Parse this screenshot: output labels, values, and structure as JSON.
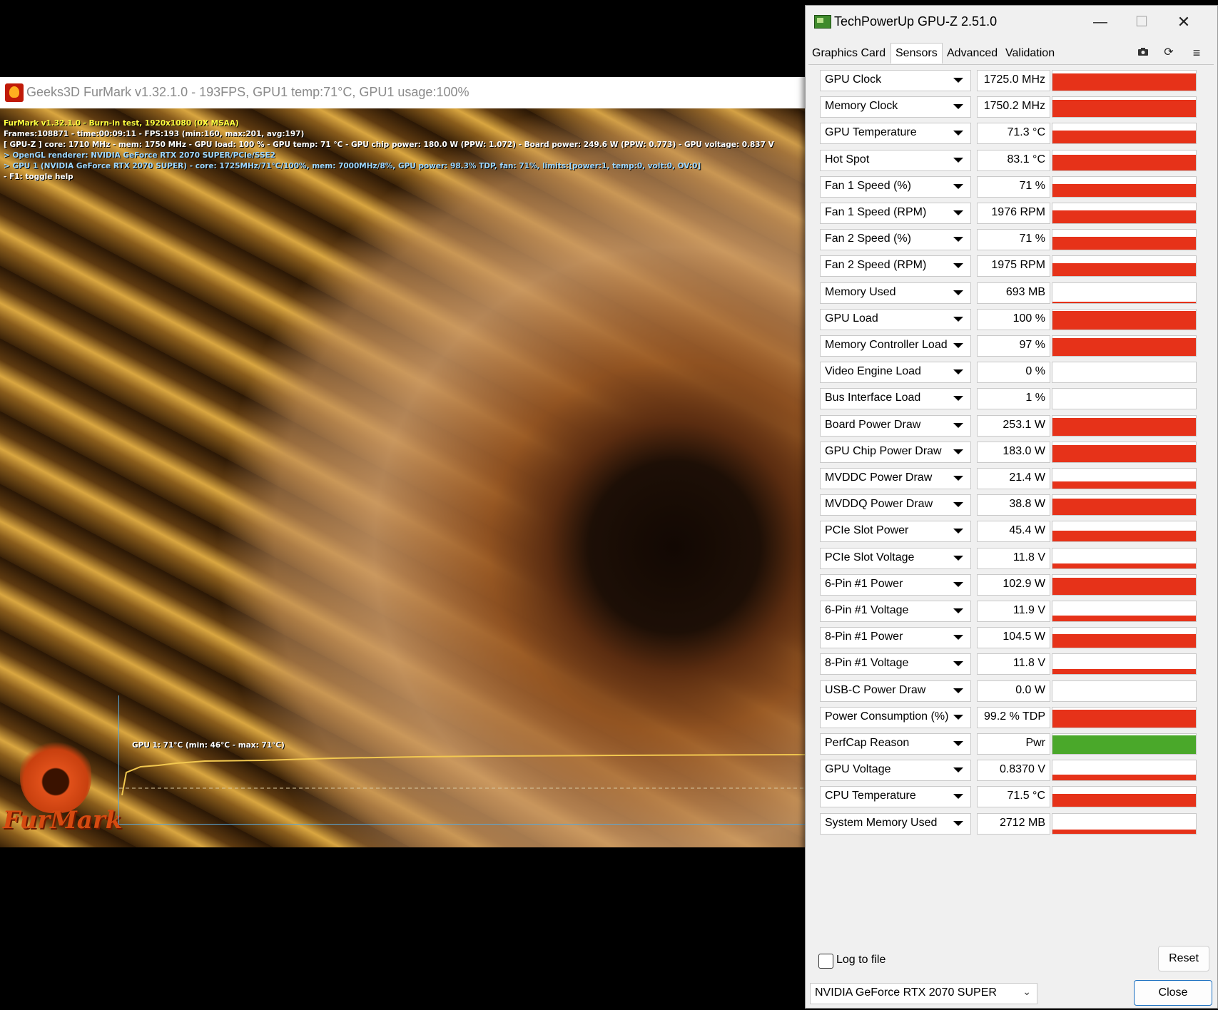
{
  "furmark": {
    "title": "Geeks3D FurMark v1.32.1.0 - 193FPS, GPU1 temp:71°C, GPU1 usage:100%",
    "hud": [
      {
        "text": "FurMark v1.32.1.0 - Burn-in test, 1920x1080 (0X MSAA)",
        "color": "yellow"
      },
      {
        "text": "Frames:108871 - time:00:09:11 - FPS:193 (min:160, max:201, avg:197)",
        "color": "white"
      },
      {
        "text": "[ GPU-Z ] core: 1710 MHz - mem: 1750 MHz - GPU load: 100 % - GPU temp: 71 °C - GPU chip power: 180.0 W (PPW: 1.072) - Board power: 249.6 W (PPW: 0.773) - GPU voltage: 0.837 V",
        "color": "white"
      },
      {
        "text": "> OpenGL renderer: NVIDIA GeForce RTX 2070 SUPER/PCIe/SSE2",
        "color": "cyan"
      },
      {
        "text": "> GPU 1 (NVIDIA GeForce RTX 2070 SUPER) - core: 1725MHz/71°C/100%, mem: 7000MHz/8%, GPU power: 98.3% TDP, fan: 71%, limits:[power:1, temp:0, volt:0, OV:0]",
        "color": "cyan"
      },
      {
        "text": "- F1: toggle help",
        "color": "white"
      }
    ],
    "graph_label": "GPU 1: 71°C (min: 46°C - max: 71°C)",
    "logo_text": "FurMark"
  },
  "gpuz": {
    "title": "TechPowerUp GPU-Z 2.51.0",
    "window_buttons": {
      "minimize": "—",
      "maximize": "☐",
      "close": "✕"
    },
    "tabs": [
      "Graphics Card",
      "Sensors",
      "Advanced",
      "Validation"
    ],
    "active_tab": "Sensors",
    "toolbar_icons": [
      "camera-icon",
      "refresh-icon",
      "menu-icon"
    ],
    "sensors": [
      {
        "name": "GPU Clock",
        "value": "1725.0 MHz",
        "level": 0.92
      },
      {
        "name": "Memory Clock",
        "value": "1750.2 MHz",
        "level": 0.92
      },
      {
        "name": "GPU Temperature",
        "value": "71.3 °C",
        "level": 0.7
      },
      {
        "name": "Hot Spot",
        "value": "83.1 °C",
        "level": 0.85
      },
      {
        "name": "Fan 1 Speed (%)",
        "value": "71 %",
        "level": 0.7
      },
      {
        "name": "Fan 1 Speed (RPM)",
        "value": "1976 RPM",
        "level": 0.7
      },
      {
        "name": "Fan 2 Speed (%)",
        "value": "71 %",
        "level": 0.7
      },
      {
        "name": "Fan 2 Speed (RPM)",
        "value": "1975 RPM",
        "level": 0.7
      },
      {
        "name": "Memory Used",
        "value": "693 MB",
        "level": 0.08
      },
      {
        "name": "GPU Load",
        "value": "100 %",
        "level": 1.0
      },
      {
        "name": "Memory Controller Load",
        "value": "97 %",
        "level": 0.97
      },
      {
        "name": "Video Engine Load",
        "value": "0 %",
        "level": 0
      },
      {
        "name": "Bus Interface Load",
        "value": "1 %",
        "level": 0
      },
      {
        "name": "Board Power Draw",
        "value": "253.1 W",
        "level": 0.95
      },
      {
        "name": "GPU Chip Power Draw",
        "value": "183.0 W",
        "level": 0.9
      },
      {
        "name": "MVDDC Power Draw",
        "value": "21.4 W",
        "level": 0.4
      },
      {
        "name": "MVDDQ Power Draw",
        "value": "38.8 W",
        "level": 0.9
      },
      {
        "name": "PCIe Slot Power",
        "value": "45.4 W",
        "level": 0.6
      },
      {
        "name": "PCIe Slot Voltage",
        "value": "11.8 V",
        "level": 0.25
      },
      {
        "name": "6-Pin #1 Power",
        "value": "102.9 W",
        "level": 0.9
      },
      {
        "name": "6-Pin #1 Voltage",
        "value": "11.9 V",
        "level": 0.3
      },
      {
        "name": "8-Pin #1 Power",
        "value": "104.5 W",
        "level": 0.75
      },
      {
        "name": "8-Pin #1 Voltage",
        "value": "11.8 V",
        "level": 0.3
      },
      {
        "name": "USB-C Power Draw",
        "value": "0.0 W",
        "level": 0
      },
      {
        "name": "Power Consumption (%)",
        "value": "99.2 % TDP",
        "level": 0.95,
        "color": "#e63219"
      },
      {
        "name": "PerfCap Reason",
        "value": "Pwr",
        "level": 1.0,
        "color": "#4aa82a"
      },
      {
        "name": "GPU Voltage",
        "value": "0.8370 V",
        "level": 0.3
      },
      {
        "name": "CPU Temperature",
        "value": "71.5 °C",
        "level": 0.7
      },
      {
        "name": "System Memory Used",
        "value": "2712 MB",
        "level": 0.2
      }
    ],
    "log_label": "Log to file",
    "reset_label": "Reset",
    "device": "NVIDIA GeForce RTX 2070 SUPER",
    "close_label": "Close",
    "bar_color": "#e63219"
  }
}
